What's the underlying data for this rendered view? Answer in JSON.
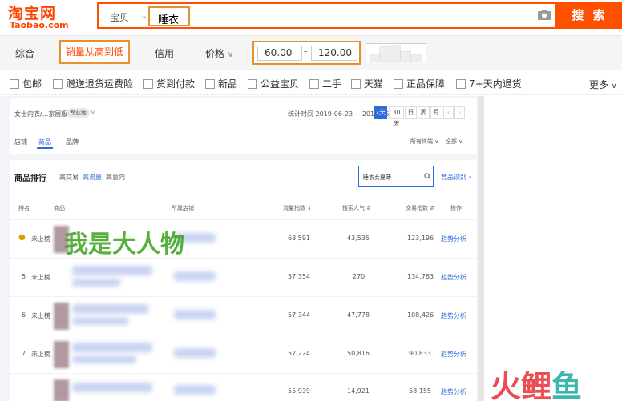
{
  "brand": {
    "name_cn": "淘宝网",
    "name_en": "Taobao.com"
  },
  "search": {
    "category": "宝贝",
    "query": "睡衣",
    "button": "搜 索"
  },
  "sort": {
    "items": [
      "综合",
      "销量从高到低",
      "信用",
      "价格"
    ],
    "price_min": "60.00",
    "price_max": "120.00",
    "dash": "-"
  },
  "filters": {
    "items": [
      "包邮",
      "赠送退货运费险",
      "货到付款",
      "新品",
      "公益宝贝",
      "二手",
      "天猫",
      "正品保障",
      "7+天内退货"
    ],
    "more": "更多"
  },
  "panel": {
    "breadcrumb": "女士内衣/...家居服套装",
    "tag": "专业版",
    "stat_time": "统计时间 2019-06-23 ~ 2019-06-29",
    "date_btns": [
      "7天",
      "30天",
      "日",
      "周",
      "月"
    ],
    "tabs": [
      "店铺",
      "商品",
      "品牌"
    ],
    "right_opts": [
      "所有终端",
      "全部"
    ],
    "rank_title": "商品排行",
    "rank_tabs": [
      "高交易",
      "高流量",
      "高意向"
    ],
    "mini_search": "睡衣女夏薄",
    "monitor": "竞品识别",
    "columns": [
      "排名",
      "商品",
      "所属店铺",
      "流量指数",
      "搜索人气",
      "交易指数",
      "操作"
    ],
    "rows": [
      {
        "rank": "",
        "status": "未上榜",
        "traffic": "68,591",
        "search": "43,535",
        "trade": "123,196",
        "action": "趋势分析"
      },
      {
        "rank": "5",
        "status": "未上榜",
        "traffic": "57,354",
        "search": "270",
        "trade": "134,763",
        "action": "趋势分析"
      },
      {
        "rank": "6",
        "status": "未上榜",
        "traffic": "57,344",
        "search": "47,778",
        "trade": "108,426",
        "action": "趋势分析"
      },
      {
        "rank": "7",
        "status": "未上榜",
        "traffic": "57,224",
        "search": "50,816",
        "trade": "90,833",
        "action": "趋势分析"
      },
      {
        "rank": "",
        "status": "",
        "traffic": "55,939",
        "search": "14,921",
        "trade": "58,155",
        "action": "趋势分析"
      }
    ],
    "watermark": "我是大人物"
  },
  "corner_logo": {
    "p1": "火",
    "p2": "鲤",
    "p3": "鱼"
  }
}
